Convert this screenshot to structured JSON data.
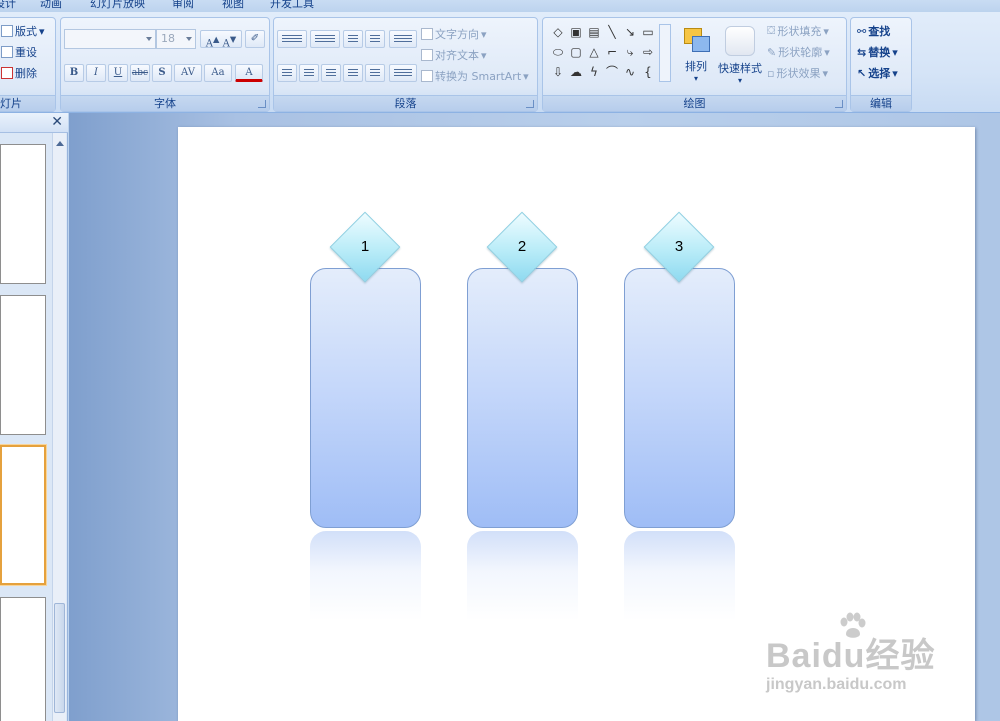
{
  "tabs": [
    "设计",
    "动画",
    "幻灯片放映",
    "审阅",
    "视图",
    "开发工具"
  ],
  "slides_group": {
    "label": "幻灯片",
    "layout": "版式",
    "reset": "重设",
    "delete": "删除"
  },
  "font_group": {
    "label": "字体",
    "font_size": "18",
    "buttons": [
      "B",
      "I",
      "U",
      "abc",
      "S",
      "AV",
      "Aa",
      "A"
    ]
  },
  "paragraph_group": {
    "label": "段落",
    "text_direction": "文字方向",
    "align_text": "对齐文本",
    "smartart": "转换为 SmartArt"
  },
  "drawing_group": {
    "label": "绘图",
    "arrange": "排列",
    "quick_styles": "快速样式",
    "shape_fill": "形状填充",
    "shape_outline": "形状轮廓",
    "shape_effects": "形状效果"
  },
  "editing_group": {
    "label": "编辑",
    "find": "查找",
    "replace": "替换",
    "select": "选择"
  },
  "slide": {
    "diamonds": [
      "1",
      "2",
      "3"
    ]
  },
  "watermark": {
    "logo": "Baidu经验",
    "url": "jingyan.baidu.com"
  },
  "colors": {
    "ribbon_text": "#15428b",
    "pillar_bottom": "#9fbdf6",
    "diamond": "#b9ecf8",
    "selected_thumb": "#e5a13d"
  }
}
